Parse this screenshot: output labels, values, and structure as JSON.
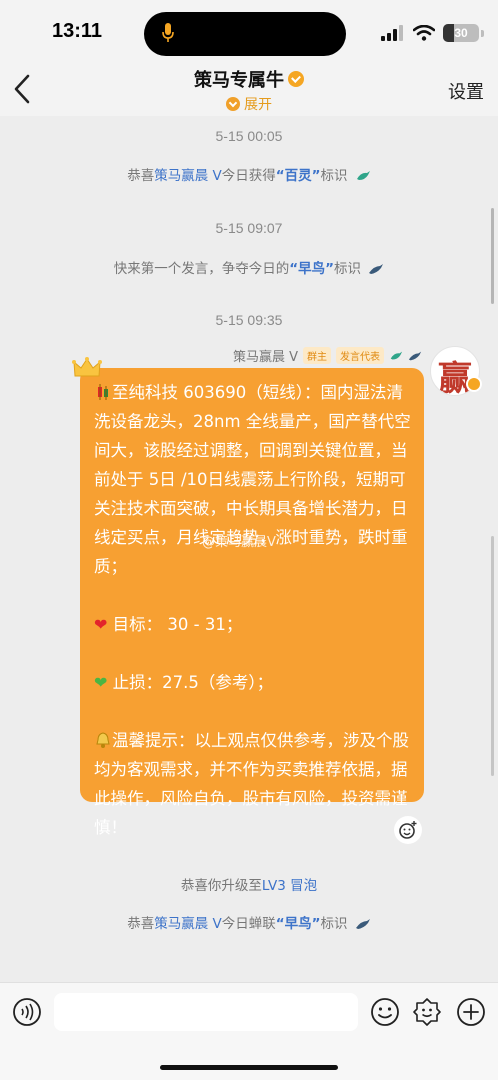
{
  "status_bar": {
    "time": "13:11",
    "battery": "30",
    "battery_level": 0.3
  },
  "nav": {
    "title": "策马专属牛",
    "subtitle": "展开",
    "settings": "设置"
  },
  "messages": {
    "ts1": "5-15 00:05",
    "sys1": {
      "prefix": "恭喜",
      "name": "策马赢晨 V",
      "middle": "今日获得",
      "badge": "“百灵”",
      "suffix": "标识"
    },
    "ts2": "5-15 09:07",
    "sys2": {
      "prefix": "快来第一个发言，争夺今日的",
      "badge": "“早鸟”",
      "suffix": "标识"
    },
    "ts3": "5-15 09:35",
    "sender": {
      "name": "策马赢晨 V",
      "tag_owner": "群主",
      "tag_speaker": "发言代表"
    },
    "avatar_char": "赢",
    "bubble": {
      "para1": "至纯科技 603690（短线）：国内湿法清洗设备龙头，28nm 全线量产，国产替代空间大，该股经过调整，回调到关键位置，当前处于 5日 /10日线震荡上行阶段，短期可关注技术面突破，中长期具备增长潜力，日线定买点，月线定趋势，涨时重势，跌时重质；",
      "target": "目标： 30 - 31；",
      "stop": "止损：27.5（参考）；",
      "tip": "温馨提示：以上观点仅供参考，涉及个股均为客观需求，并不作为买卖推荐依据，据此操作，风险自负，股市有风险，投资需谨慎！",
      "watermark": "@策马赢晨V"
    },
    "sys3": {
      "prefix": "恭喜你升级至",
      "level": "LV3 冒泡"
    },
    "sys4": {
      "prefix": "恭喜",
      "name": "策马赢晨 V",
      "middle": "今日蝉联",
      "badge": "“早鸟”",
      "suffix": "标识"
    }
  },
  "input": {
    "placeholder": ""
  },
  "colors": {
    "bubble": "#f7a032",
    "accent": "#e59b1c",
    "link": "#3d73c9"
  }
}
